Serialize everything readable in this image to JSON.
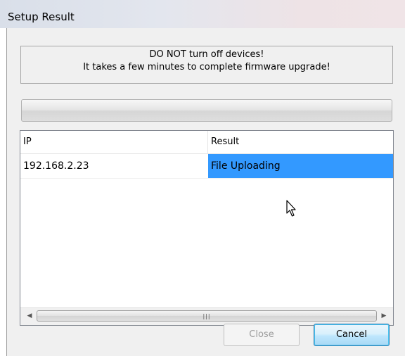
{
  "window": {
    "title": "Setup Result"
  },
  "notice": {
    "line1": "DO NOT turn off devices!",
    "line2": "It takes a few minutes to complete firmware upgrade!"
  },
  "progress": {
    "value": 0
  },
  "table": {
    "columns": [
      "IP",
      "Result"
    ],
    "rows": [
      {
        "ip": "192.168.2.23",
        "result": "File Uploading",
        "selected_cell": "result"
      }
    ]
  },
  "buttons": {
    "close_label": "Close",
    "close_enabled": false,
    "cancel_label": "Cancel"
  },
  "colors": {
    "selection": "#3399ff",
    "dialog_bg": "#f0f0f0"
  },
  "icons": {
    "cursor": "mouse-pointer-icon",
    "scroll_left": "scroll-left-arrow-icon",
    "scroll_right": "scroll-right-arrow-icon"
  }
}
